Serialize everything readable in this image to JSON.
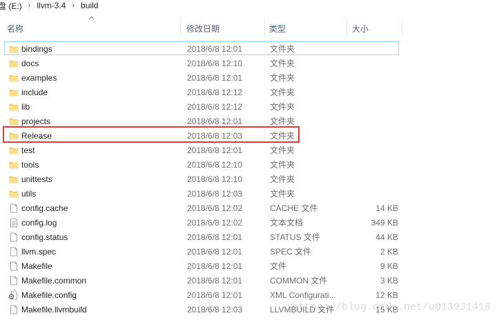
{
  "breadcrumb": [
    "盘 (E:)",
    "llvm-3.4",
    "build"
  ],
  "columns": {
    "name": "名称",
    "date": "修改日期",
    "type": "类型",
    "size": "大小"
  },
  "files": [
    {
      "name": "bindings",
      "date": "2018/6/8 12:01",
      "type": "文件夹",
      "size": "",
      "icon": "folder"
    },
    {
      "name": "docs",
      "date": "2018/6/8 12:10",
      "type": "文件夹",
      "size": "",
      "icon": "folder"
    },
    {
      "name": "examples",
      "date": "2018/6/8 12:01",
      "type": "文件夹",
      "size": "",
      "icon": "folder"
    },
    {
      "name": "include",
      "date": "2018/6/8 12:12",
      "type": "文件夹",
      "size": "",
      "icon": "folder"
    },
    {
      "name": "lib",
      "date": "2018/6/8 12:12",
      "type": "文件夹",
      "size": "",
      "icon": "folder"
    },
    {
      "name": "projects",
      "date": "2018/6/8 12:01",
      "type": "文件夹",
      "size": "",
      "icon": "folder"
    },
    {
      "name": "Release",
      "date": "2018/6/8 12:03",
      "type": "文件夹",
      "size": "",
      "icon": "folder"
    },
    {
      "name": "test",
      "date": "2018/6/8 12:01",
      "type": "文件夹",
      "size": "",
      "icon": "folder"
    },
    {
      "name": "tools",
      "date": "2018/6/8 12:10",
      "type": "文件夹",
      "size": "",
      "icon": "folder"
    },
    {
      "name": "unittests",
      "date": "2018/6/8 12:10",
      "type": "文件夹",
      "size": "",
      "icon": "folder"
    },
    {
      "name": "utils",
      "date": "2018/6/8 12:03",
      "type": "文件夹",
      "size": "",
      "icon": "folder"
    },
    {
      "name": "config.cache",
      "date": "2018/6/8 12:02",
      "type": "CACHE 文件",
      "size": "14 KB",
      "icon": "file"
    },
    {
      "name": "config.log",
      "date": "2018/6/8 12:02",
      "type": "文本文档",
      "size": "349 KB",
      "icon": "text"
    },
    {
      "name": "config.status",
      "date": "2018/6/8 12:01",
      "type": "STATUS 文件",
      "size": "44 KB",
      "icon": "file"
    },
    {
      "name": "llvm.spec",
      "date": "2018/6/8 12:01",
      "type": "SPEC 文件",
      "size": "2 KB",
      "icon": "file"
    },
    {
      "name": "Makefile",
      "date": "2018/6/8 12:01",
      "type": "文件",
      "size": "9 KB",
      "icon": "file"
    },
    {
      "name": "Makefile.common",
      "date": "2018/6/8 12:01",
      "type": "COMMON 文件",
      "size": "3 KB",
      "icon": "file"
    },
    {
      "name": "Makefile.config",
      "date": "2018/6/8 12:01",
      "type": "XML Configurati...",
      "size": "12 KB",
      "icon": "xml"
    },
    {
      "name": "Makefile.llvmbuild",
      "date": "2018/6/8 12:03",
      "type": "LLVMBUILD 文件",
      "size": "15 KB",
      "icon": "file"
    }
  ],
  "watermark": "https://blog.csdn.net/u013931418",
  "colors": {
    "folder": "#f8d775",
    "highlight": "#e53935",
    "focus": "#99d1ff"
  }
}
